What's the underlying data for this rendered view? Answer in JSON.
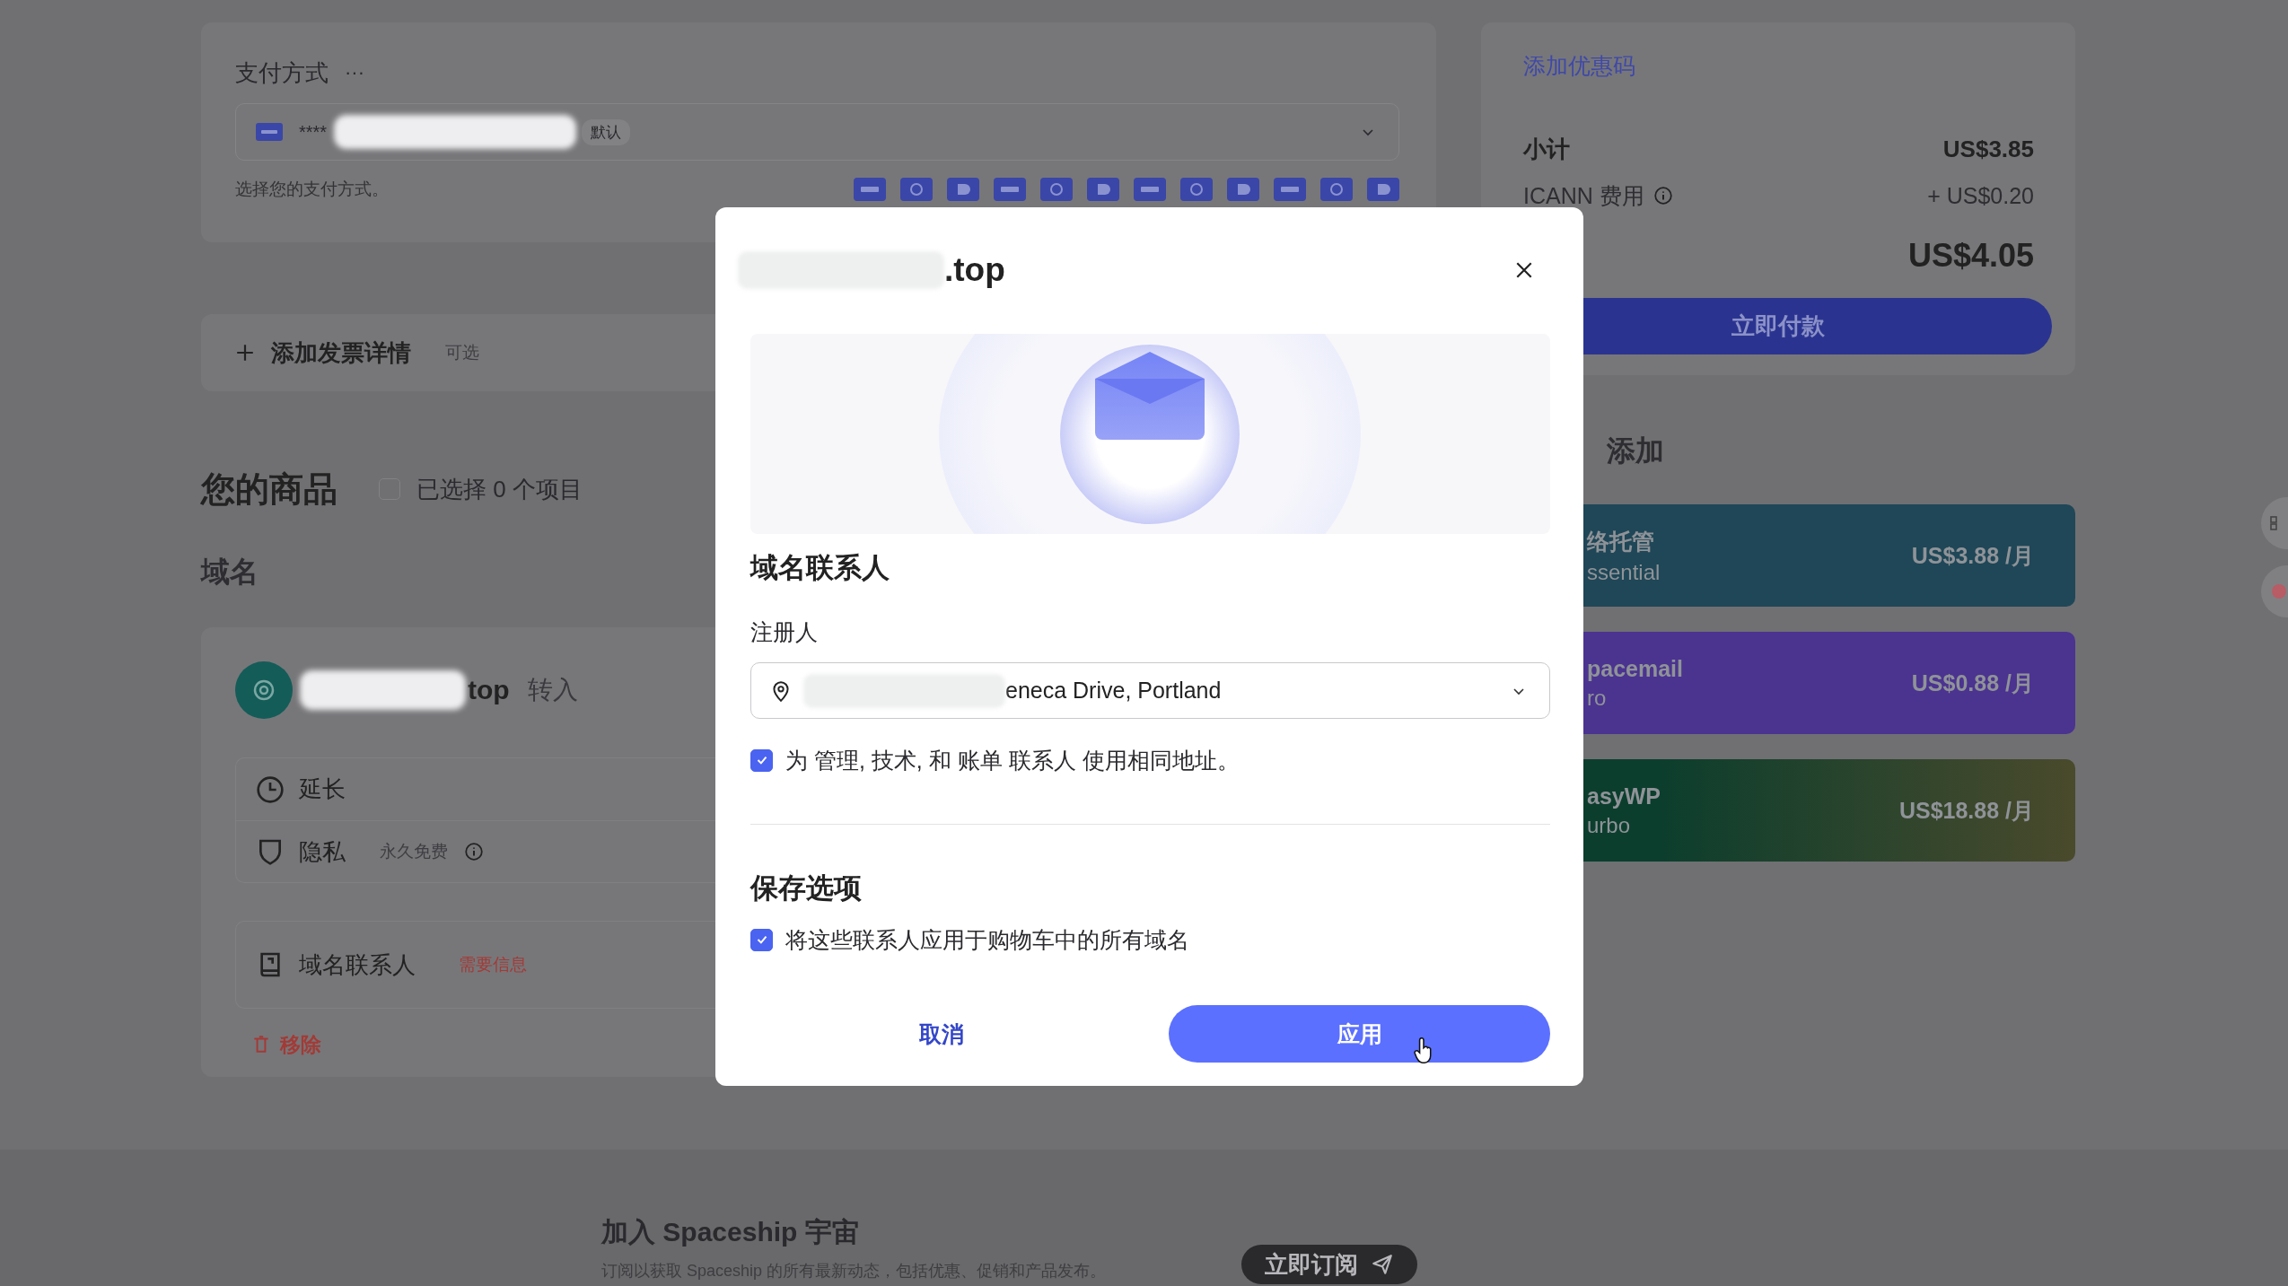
{
  "payment": {
    "title": "支付方式",
    "more": "···",
    "card_mask": "****",
    "default_badge": "默认",
    "helper": "选择您的支付方式。"
  },
  "invoice": {
    "label": "添加发票详情",
    "hint": "可选"
  },
  "products": {
    "title": "您的商品",
    "select_all": {
      "checked": false,
      "label": "已选择 0 个项目"
    }
  },
  "section": "域名",
  "domain": {
    "suffix": "top",
    "status": "转入",
    "options": [
      {
        "kind": "extend",
        "label": "延长"
      },
      {
        "kind": "privacy",
        "label": "隐私",
        "note": "永久免费"
      }
    ],
    "contacts": {
      "label": "域名联系人",
      "warning": "需要信息"
    },
    "remove": "移除"
  },
  "summary": {
    "promo_link": "添加优惠码",
    "subtotal": {
      "label": "小计",
      "value": "US$3.85"
    },
    "fee": {
      "label": "ICANN 费用",
      "value": "+ US$0.20"
    },
    "total": "US$4.05",
    "pay_button": "立即付款"
  },
  "addons": {
    "title": "添加",
    "items": [
      {
        "name": "络托管",
        "plan": "ssential",
        "price": "US$3.88 /月",
        "color": "#1f4757"
      },
      {
        "name": "pacemail",
        "plan": "ro",
        "price": "US$0.88 /月",
        "color": "#4b3390"
      },
      {
        "name": "asyWP",
        "plan": "urbo",
        "price": "US$18.88 /月",
        "color": "#0c3e2d"
      }
    ]
  },
  "footer": {
    "title": "加入 Spaceship 宇宙",
    "text": "订阅以获取 Spaceship 的所有最新动态，包括优惠、促销和产品发布。",
    "button": "立即订阅"
  },
  "modal": {
    "title_suffix": ".top",
    "heading": "域名联系人",
    "registrant_label": "注册人",
    "address": "eneca Drive, Portland",
    "same_address": {
      "checked": true,
      "label": "为 管理, 技术, 和 账单 联系人 使用相同地址。"
    },
    "save_heading": "保存选项",
    "apply_all": {
      "checked": true,
      "label": "将这些联系人应用于购物车中的所有域名"
    },
    "cancel": "取消",
    "apply": "应用"
  }
}
